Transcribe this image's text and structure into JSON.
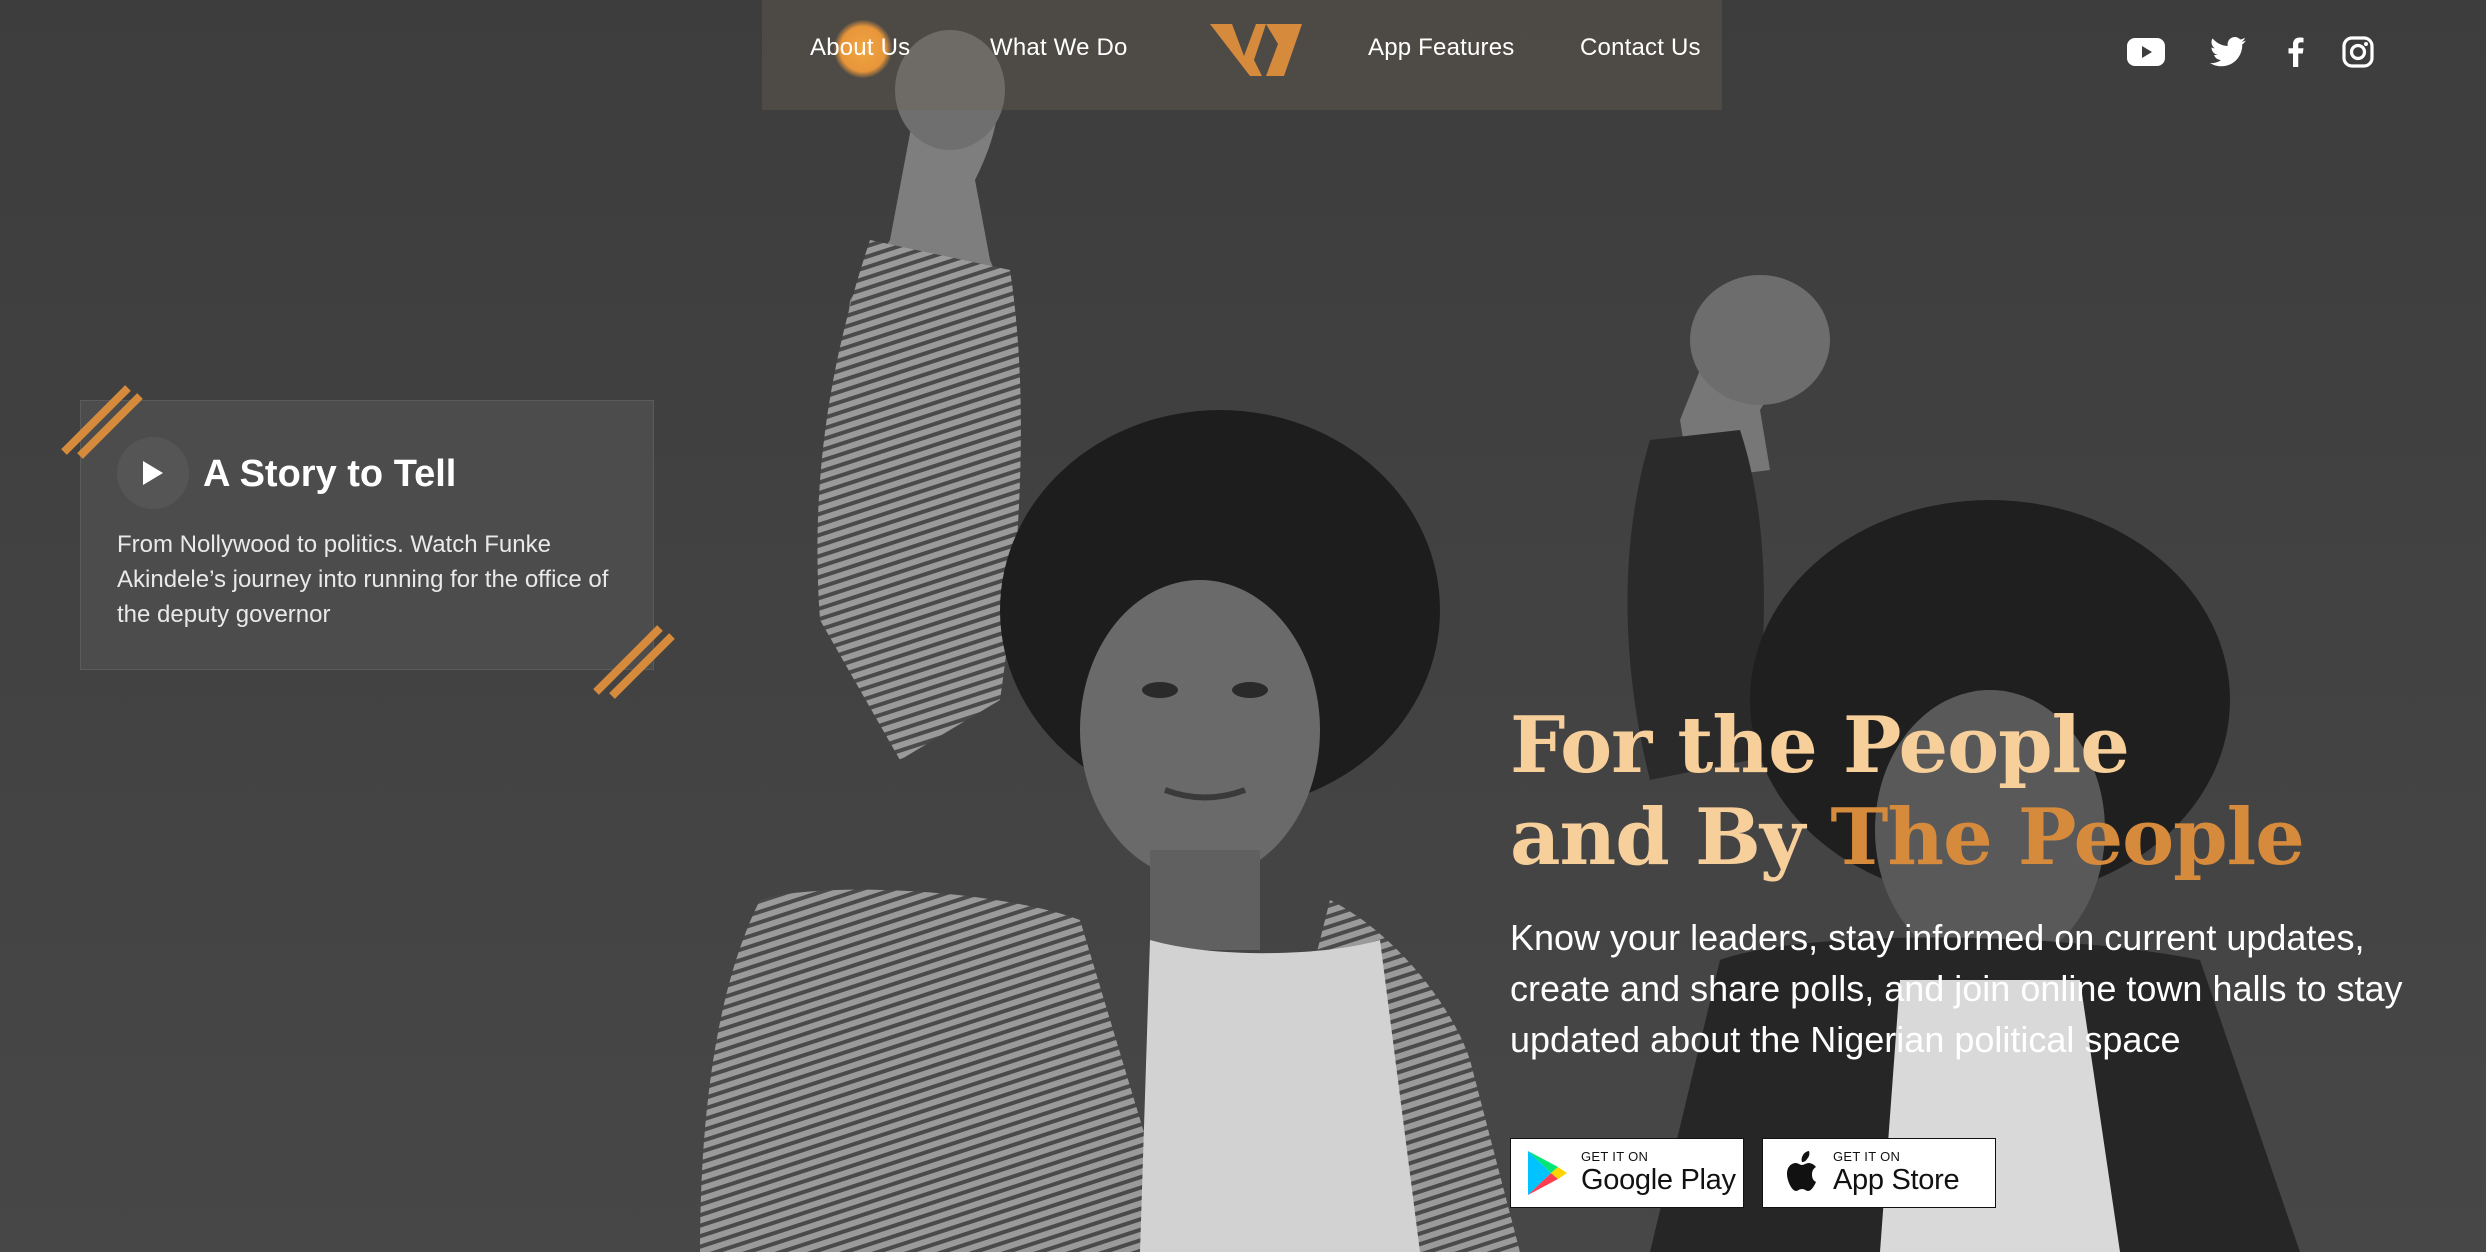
{
  "nav": {
    "links": [
      "About Us",
      "What We Do",
      "App Features",
      "Contact Us"
    ],
    "logo_letter": "W"
  },
  "social": [
    "youtube-icon",
    "twitter-icon",
    "facebook-icon",
    "instagram-icon"
  ],
  "story": {
    "title": "A Story to Tell",
    "text": "From Nollywood to politics. Watch Funke Akindele’s journey into running for the office of the deputy governor"
  },
  "hero": {
    "headline_line1": "For the People",
    "headline_line2_a": "and By ",
    "headline_line2_b": "The People",
    "subtext": "Know your leaders, stay informed on current updates, create and share polls, and join online town halls to stay updated about the Nigerian political space"
  },
  "stores": {
    "google": {
      "small": "GET IT ON",
      "big": "Google Play"
    },
    "apple": {
      "small": "GET IT ON",
      "big": "App Store"
    }
  },
  "colors": {
    "accent": "#d68a3c",
    "headline_light": "#f6cf9a",
    "background": "#404040"
  }
}
